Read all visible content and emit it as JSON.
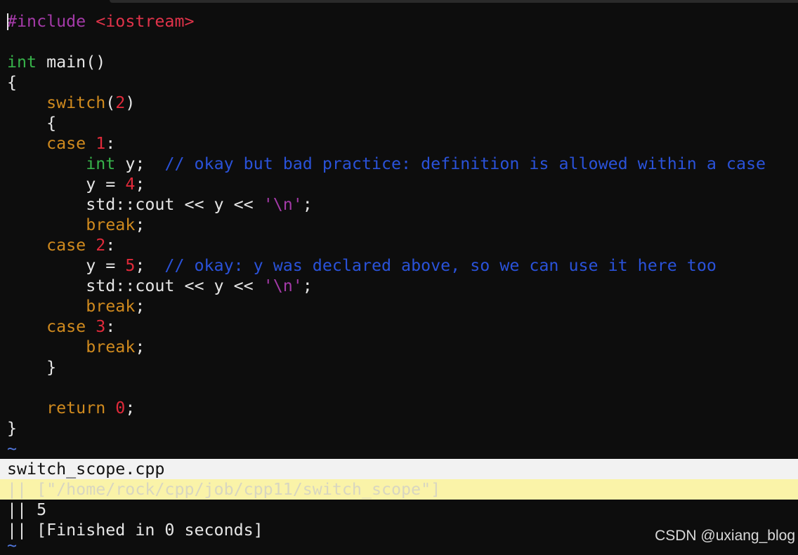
{
  "editor": {
    "lines": [
      {
        "segments": [
          {
            "cls": "pp",
            "text": "#include"
          },
          {
            "cls": "",
            "text": " "
          },
          {
            "cls": "inc",
            "text": "<iostream>"
          }
        ]
      },
      {
        "segments": []
      },
      {
        "segments": [
          {
            "cls": "ty",
            "text": "int"
          },
          {
            "cls": "",
            "text": " main()"
          }
        ]
      },
      {
        "segments": [
          {
            "cls": "",
            "text": "{"
          }
        ]
      },
      {
        "segments": [
          {
            "cls": "",
            "text": "    "
          },
          {
            "cls": "kw",
            "text": "switch"
          },
          {
            "cls": "",
            "text": "("
          },
          {
            "cls": "num",
            "text": "2"
          },
          {
            "cls": "",
            "text": ")"
          }
        ]
      },
      {
        "segments": [
          {
            "cls": "",
            "text": "    {"
          }
        ]
      },
      {
        "segments": [
          {
            "cls": "",
            "text": "    "
          },
          {
            "cls": "kw",
            "text": "case"
          },
          {
            "cls": "",
            "text": " "
          },
          {
            "cls": "num",
            "text": "1"
          },
          {
            "cls": "",
            "text": ":"
          }
        ]
      },
      {
        "segments": [
          {
            "cls": "",
            "text": "        "
          },
          {
            "cls": "ty",
            "text": "int"
          },
          {
            "cls": "",
            "text": " y;  "
          },
          {
            "cls": "cm",
            "text": "// okay but bad practice: definition is allowed within a case"
          }
        ]
      },
      {
        "segments": [
          {
            "cls": "",
            "text": "        y = "
          },
          {
            "cls": "num",
            "text": "4"
          },
          {
            "cls": "",
            "text": ";"
          }
        ]
      },
      {
        "segments": [
          {
            "cls": "",
            "text": "        std::cout << y << "
          },
          {
            "cls": "str",
            "text": "'\\n'"
          },
          {
            "cls": "",
            "text": ";"
          }
        ]
      },
      {
        "segments": [
          {
            "cls": "",
            "text": "        "
          },
          {
            "cls": "kw",
            "text": "break"
          },
          {
            "cls": "",
            "text": ";"
          }
        ]
      },
      {
        "segments": [
          {
            "cls": "",
            "text": "    "
          },
          {
            "cls": "kw",
            "text": "case"
          },
          {
            "cls": "",
            "text": " "
          },
          {
            "cls": "num",
            "text": "2"
          },
          {
            "cls": "",
            "text": ":"
          }
        ]
      },
      {
        "segments": [
          {
            "cls": "",
            "text": "        y = "
          },
          {
            "cls": "num",
            "text": "5"
          },
          {
            "cls": "",
            "text": ";  "
          },
          {
            "cls": "cm",
            "text": "// okay: y was declared above, so we can use it here too"
          }
        ]
      },
      {
        "segments": [
          {
            "cls": "",
            "text": "        std::cout << y << "
          },
          {
            "cls": "str",
            "text": "'\\n'"
          },
          {
            "cls": "",
            "text": ";"
          }
        ]
      },
      {
        "segments": [
          {
            "cls": "",
            "text": "        "
          },
          {
            "cls": "kw",
            "text": "break"
          },
          {
            "cls": "",
            "text": ";"
          }
        ]
      },
      {
        "segments": [
          {
            "cls": "",
            "text": "    "
          },
          {
            "cls": "kw",
            "text": "case"
          },
          {
            "cls": "",
            "text": " "
          },
          {
            "cls": "num",
            "text": "3"
          },
          {
            "cls": "",
            "text": ":"
          }
        ]
      },
      {
        "segments": [
          {
            "cls": "",
            "text": "        "
          },
          {
            "cls": "kw",
            "text": "break"
          },
          {
            "cls": "",
            "text": ";"
          }
        ]
      },
      {
        "segments": [
          {
            "cls": "",
            "text": "    }"
          }
        ]
      },
      {
        "segments": []
      },
      {
        "segments": [
          {
            "cls": "",
            "text": "    "
          },
          {
            "cls": "kw",
            "text": "return"
          },
          {
            "cls": "",
            "text": " "
          },
          {
            "cls": "num",
            "text": "0"
          },
          {
            "cls": "",
            "text": ";"
          }
        ]
      },
      {
        "segments": [
          {
            "cls": "",
            "text": "}"
          }
        ]
      },
      {
        "segments": [
          {
            "cls": "tilde",
            "text": "~"
          }
        ]
      }
    ]
  },
  "quickfix": {
    "title": "switch_scope.cpp",
    "selected": "|| [\"/home/rock/cpp/job/cpp11/switch_scope\"]",
    "output_line": "|| 5",
    "finished_line": "|| [Finished in 0 seconds]",
    "end_marker": "~"
  },
  "watermark": "CSDN @uxiang_blog",
  "colors": {
    "background": "#0d0d0d",
    "type": "#37b24a",
    "keyword": "#d08a1e",
    "number": "#e02a3a",
    "comment": "#2a52d9",
    "preprocessor": "#a43aa8",
    "selection": "#faf3a8"
  }
}
